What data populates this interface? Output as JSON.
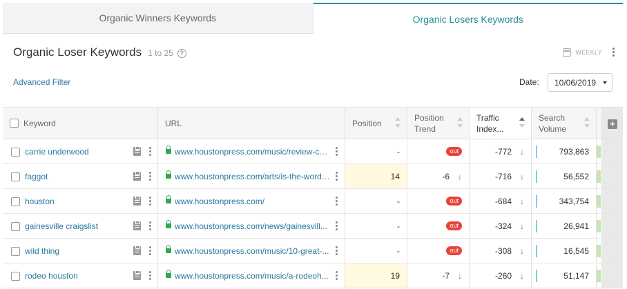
{
  "tabs": [
    {
      "label": "Organic Winners Keywords"
    },
    {
      "label": "Organic Losers Keywords"
    }
  ],
  "header": {
    "title": "Organic Loser Keywords",
    "range": "1 to 25",
    "help_icon": "?",
    "period": "WEEKLY",
    "advanced_filter": "Advanced Filter",
    "date_label": "Date:",
    "date_value": "10/06/2019"
  },
  "columns": {
    "keyword": "Keyword",
    "url": "URL",
    "position": "Position",
    "position_trend": "Position Trend",
    "traffic_index": "Traffic Index...",
    "search_volume": "Search Volume"
  },
  "rows": [
    {
      "keyword": "carrie underwood",
      "url": "www.houstonpress.com/music/review-ca...",
      "position": "-",
      "trend": "out",
      "traffic_index": "-772",
      "search_volume": "793,863"
    },
    {
      "keyword": "faggot",
      "url": "www.houstonpress.com/arts/is-the-word-...",
      "position": "14",
      "trend": "-6",
      "traffic_index": "-716",
      "search_volume": "56,552"
    },
    {
      "keyword": "houston",
      "url": "www.houstonpress.com/",
      "position": "-",
      "trend": "out",
      "traffic_index": "-684",
      "search_volume": "343,754"
    },
    {
      "keyword": "gainesville craigslist",
      "url": "www.houstonpress.com/news/gainesvill...",
      "position": "-",
      "trend": "out",
      "traffic_index": "-324",
      "search_volume": "26,941"
    },
    {
      "keyword": "wild thing",
      "url": "www.houstonpress.com/music/10-great-...",
      "position": "-",
      "trend": "out",
      "traffic_index": "-308",
      "search_volume": "16,545"
    },
    {
      "keyword": "rodeo houston",
      "url": "www.houstonpress.com/music/a-rodeoh...",
      "position": "19",
      "trend": "-7",
      "traffic_index": "-260",
      "search_volume": "51,147"
    }
  ],
  "colors": {
    "accent": "#2a8c9e",
    "link": "#2a7a9e",
    "out_badge": "#e8443a",
    "secure_lock": "#2fa84f"
  },
  "icons": {
    "help": "help-icon",
    "calendar": "calendar-icon",
    "kebab": "kebab-menu-icon",
    "lock": "lock-icon",
    "clipboard": "clipboard-icon",
    "down_arrow": "arrow-down-icon",
    "add_column": "plus-icon"
  }
}
